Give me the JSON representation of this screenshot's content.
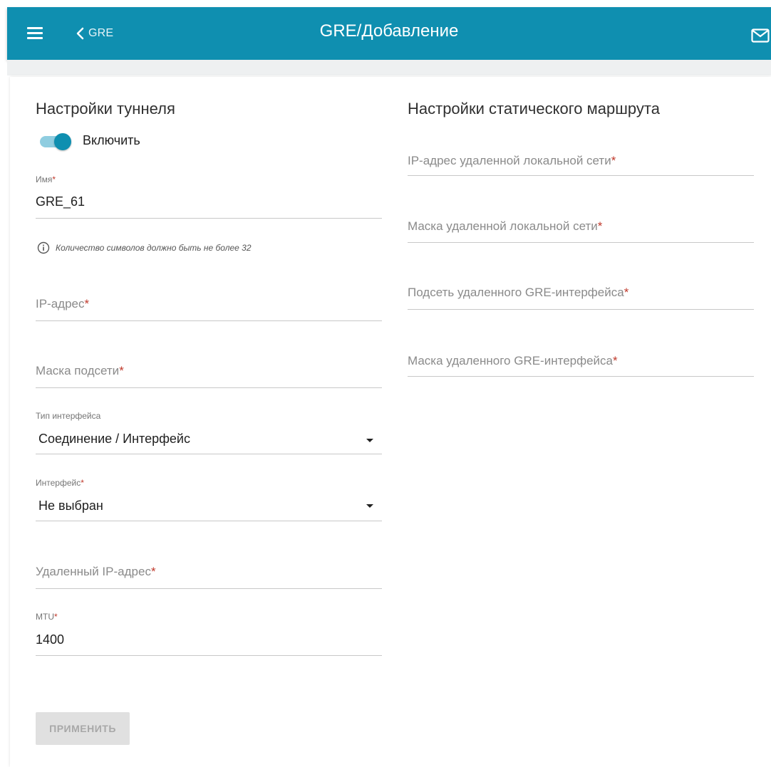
{
  "header": {
    "back_label": "GRE",
    "title": "GRE/Добавление",
    "accent_color": "#0f8fb0"
  },
  "tunnel": {
    "section_title": "Настройки туннеля",
    "enable_label": "Включить",
    "enabled": true,
    "name": {
      "label": "Имя",
      "value": "GRE_61"
    },
    "name_hint": "Количество символов должно быть не более 32",
    "ip_address": {
      "placeholder": "IP-адрес"
    },
    "subnet_mask": {
      "placeholder": "Маска подсети"
    },
    "interface_type": {
      "label": "Тип интерфейса",
      "value": "Соединение / Интерфейс"
    },
    "interface": {
      "label": "Интерфейс",
      "value": "Не выбран"
    },
    "remote_ip": {
      "placeholder": "Удаленный IP-адрес"
    },
    "mtu": {
      "label": "MTU",
      "value": "1400"
    },
    "apply_label": "ПРИМЕНИТЬ"
  },
  "static_route": {
    "section_title": "Настройки статического маршрута",
    "remote_lan_ip": {
      "placeholder": "IP-адрес удаленной локальной сети"
    },
    "remote_lan_mask": {
      "placeholder": "Маска удаленной локальной сети"
    },
    "remote_gre_subnet": {
      "placeholder": "Подсеть удаленного GRE-интерфейса"
    },
    "remote_gre_mask": {
      "placeholder": "Маска удаленного GRE-интерфейса"
    }
  },
  "required_mark": "*",
  "icons": [
    "menu-icon",
    "chevron-left-icon",
    "mail-icon",
    "info-icon",
    "dropdown-caret-icon"
  ]
}
